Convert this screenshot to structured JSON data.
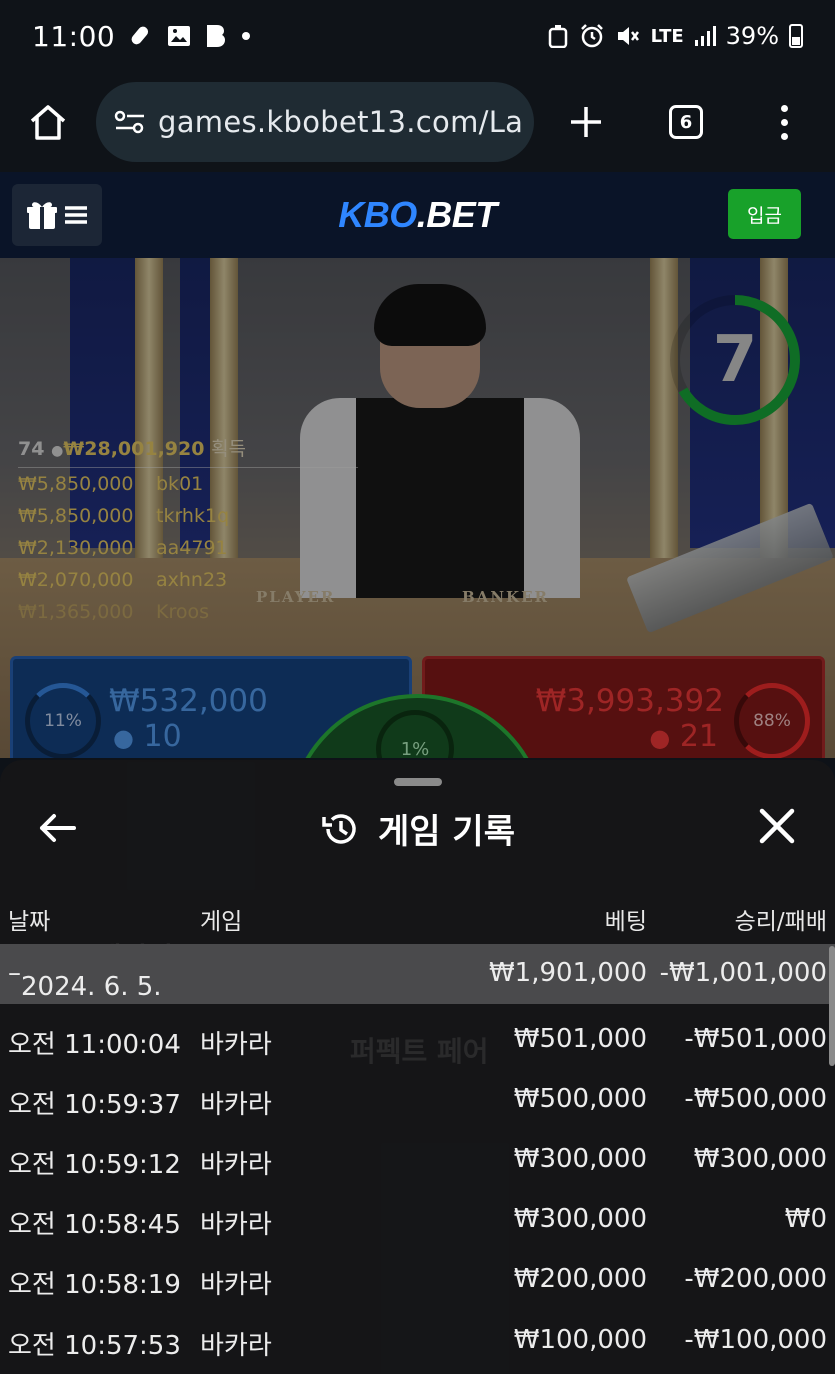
{
  "status_bar": {
    "time": "11:00",
    "network": "LTE",
    "battery": "39%"
  },
  "browser": {
    "url": "games.kbobet13.com/La",
    "tab_count": "6"
  },
  "site": {
    "logo_kbo": "KBO",
    "logo_bet": ".BET",
    "deposit_label": "입금"
  },
  "game": {
    "timer": "7",
    "table_player": "PLAYER",
    "table_banker": "BANKER",
    "winners_header": {
      "count": "74",
      "total": "₩28,001,920",
      "suffix": "획득"
    },
    "winners": [
      {
        "amount": "₩5,850,000",
        "name": "bk01"
      },
      {
        "amount": "₩5,850,000",
        "name": "tkrhk1q"
      },
      {
        "amount": "₩2,130,000",
        "name": "aa4791"
      },
      {
        "amount": "₩2,070,000",
        "name": "axhn23"
      },
      {
        "amount": "₩1,365,000",
        "name": "Kroos"
      }
    ],
    "player_bet": {
      "percent": "11%",
      "amount": "₩532,000",
      "count": "10"
    },
    "banker_bet": {
      "percent": "88%",
      "amount": "₩3,993,392",
      "count": "21"
    },
    "tie_bet": {
      "percent": "1%"
    }
  },
  "history": {
    "title": "게임 기록",
    "columns": {
      "date": "날짜",
      "game": "게임",
      "bet": "베팅",
      "win_loss": "승리/패배"
    },
    "summary": {
      "date": "2024. 6. 5.",
      "bet": "₩1,901,000",
      "win_loss": "-₩1,001,000"
    },
    "rows": [
      {
        "time": "오전 11:00:04",
        "game": "바카라",
        "bet": "₩501,000",
        "win_loss": "-₩501,000"
      },
      {
        "time": "오전 10:59:37",
        "game": "바카라",
        "bet": "₩500,000",
        "win_loss": "-₩500,000"
      },
      {
        "time": "오전 10:59:12",
        "game": "바카라",
        "bet": "₩300,000",
        "win_loss": "₩300,000"
      },
      {
        "time": "오전 10:58:45",
        "game": "바카라",
        "bet": "₩300,000",
        "win_loss": "₩0"
      },
      {
        "time": "오전 10:58:19",
        "game": "바카라",
        "bet": "₩200,000",
        "win_loss": "-₩200,000"
      },
      {
        "time": "오전 10:57:53",
        "game": "바카라",
        "bet": "₩100,000",
        "win_loss": "-₩100,000"
      }
    ]
  },
  "colors": {
    "accent_blue": "#2f86ff",
    "deposit_green": "#18a12a",
    "player_blue": "#5aa7ff",
    "banker_red": "#ff3d3d",
    "winner_gold": "#f2d36a"
  }
}
